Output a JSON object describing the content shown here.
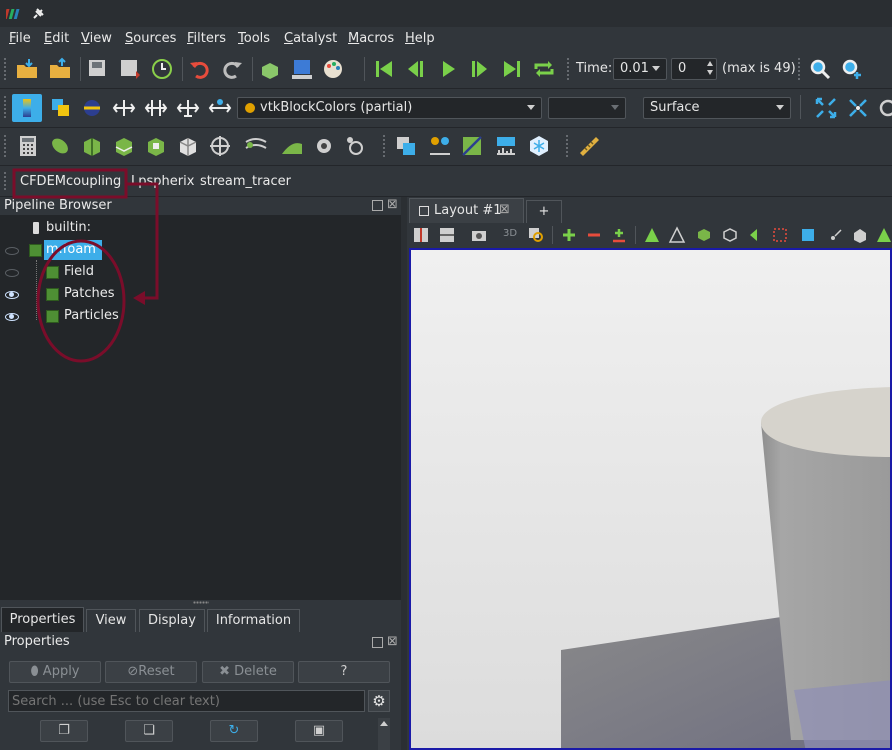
{
  "menu": [
    "File",
    "Edit",
    "View",
    "Sources",
    "Filters",
    "Tools",
    "Catalyst",
    "Macros",
    "Help"
  ],
  "time": {
    "label": "Time:",
    "value": "0.01",
    "index": "0",
    "max": "(max is 49)"
  },
  "coloring": {
    "array": "vtkBlockColors (partial)",
    "component": "",
    "representation": "Surface"
  },
  "toolbar3d": "3D",
  "custom_tabs": [
    "CFDEMcoupling",
    "Lpspherix",
    "stream_tracer"
  ],
  "pipeline": {
    "title": "Pipeline Browser",
    "items": [
      {
        "label": "builtin:"
      },
      {
        "label": "m.foam"
      },
      {
        "label": "Field"
      },
      {
        "label": "Patches"
      },
      {
        "label": "Particles"
      }
    ]
  },
  "layout_tab": {
    "label": "Layout #1",
    "add": "+"
  },
  "bottom_tabs": [
    "Properties",
    "View",
    "Display",
    "Information"
  ],
  "properties": {
    "title": "Properties",
    "apply": "Apply",
    "reset": "Reset",
    "delete": "Delete",
    "help": "?",
    "search_placeholder": "Search ... (use Esc to clear text)"
  },
  "colors": {
    "highlight": "#7a0d2a",
    "selection": "#3daee9",
    "viewport_border": "#1a1aa8"
  }
}
